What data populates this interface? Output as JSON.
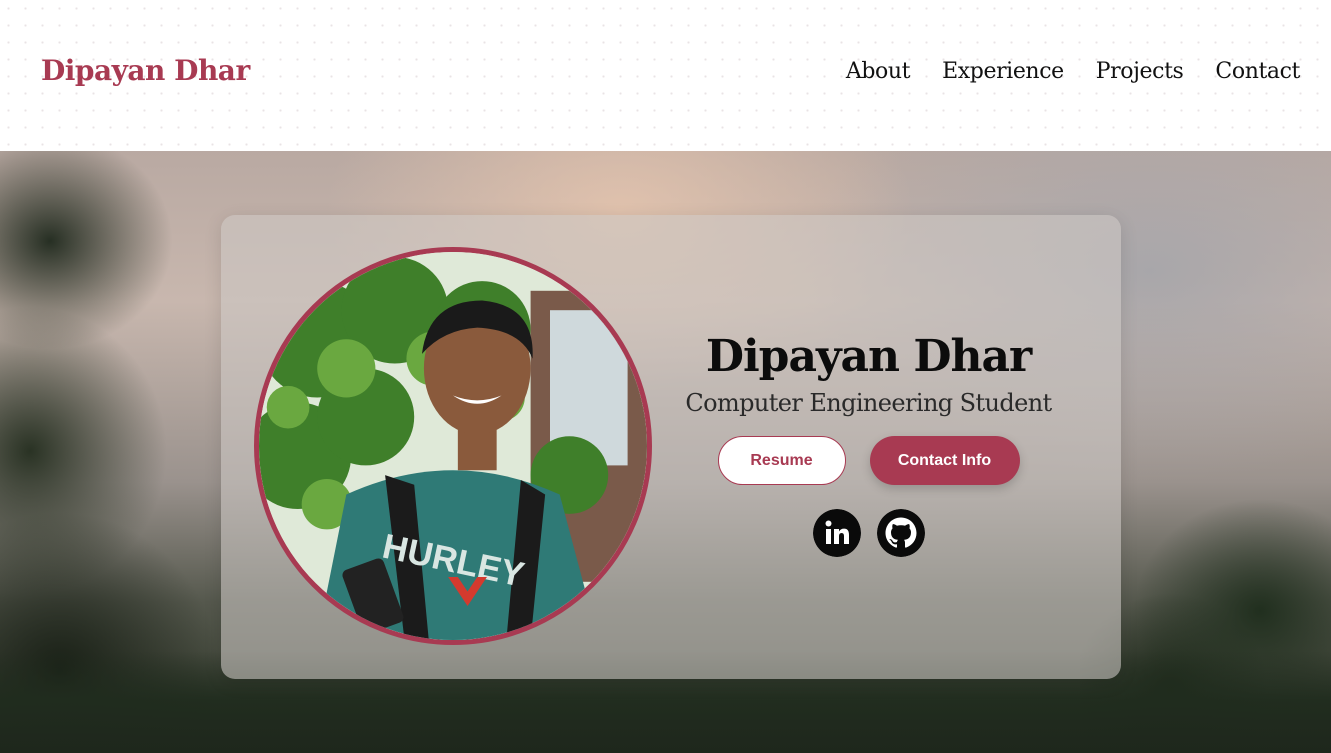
{
  "header": {
    "brand": "Dipayan Dhar",
    "nav": [
      "About",
      "Experience",
      "Projects",
      "Contact"
    ]
  },
  "hero": {
    "name": "Dipayan Dhar",
    "role": "Computer Engineering Student",
    "resume_label": "Resume",
    "contact_label": "Contact Info",
    "shirt_text": "HURLEY",
    "socials": [
      "linkedin-icon",
      "github-icon"
    ]
  },
  "colors": {
    "accent": "#a83a52",
    "text": "#0c0c0c"
  }
}
